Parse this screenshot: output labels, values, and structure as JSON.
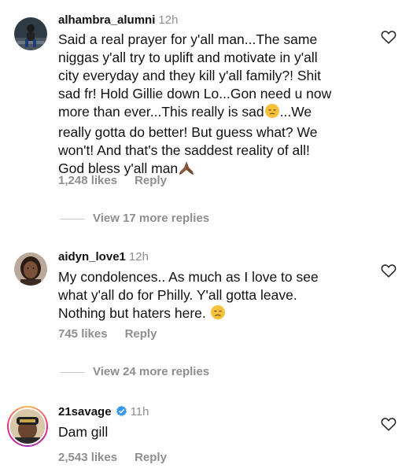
{
  "comments": [
    {
      "username": "alhambra_alumni",
      "time": "12h",
      "text_lines": [
        "Said a real prayer for y'all man...The same",
        "niggas y'all try to uplift and motivate in y'all",
        "city everyday and they kill y'all family?! Shit",
        "sad fr! Hold Gillie down Lo...Gon need u now",
        "more than ever...This really is sad",
        "...We",
        "really gotta do better! But guess what? We",
        "won't! And that's the saddest reality of all!",
        "God bless y'all man"
      ],
      "likes": "1,248 likes",
      "reply_label": "Reply",
      "view_replies": "View 17 more replies"
    },
    {
      "username": "aidyn_love1",
      "time": "12h",
      "text_lines": [
        "My condolences.. As much as I love to see",
        "what y'all do for Philly. Y'all gotta leave.",
        "Nothing but haters here."
      ],
      "likes": "745 likes",
      "reply_label": "Reply",
      "view_replies": "View 24 more replies"
    },
    {
      "username": "21savage",
      "time": "11h",
      "verified": true,
      "text_lines": [
        "Dam gill"
      ],
      "likes": "2,543 likes",
      "reply_label": "Reply"
    }
  ],
  "icons": {
    "like": "heart-outline-icon",
    "verified": "verified-badge-icon",
    "emoji_sad": "pensive-face-emoji",
    "emoji_pray": "folded-hands-emoji",
    "emoji_disappointed": "disappointed-face-emoji"
  },
  "colors": {
    "text": "#111111",
    "secondary": "#8e8e8e",
    "verified": "#3897f0",
    "background": "#ffffff"
  }
}
